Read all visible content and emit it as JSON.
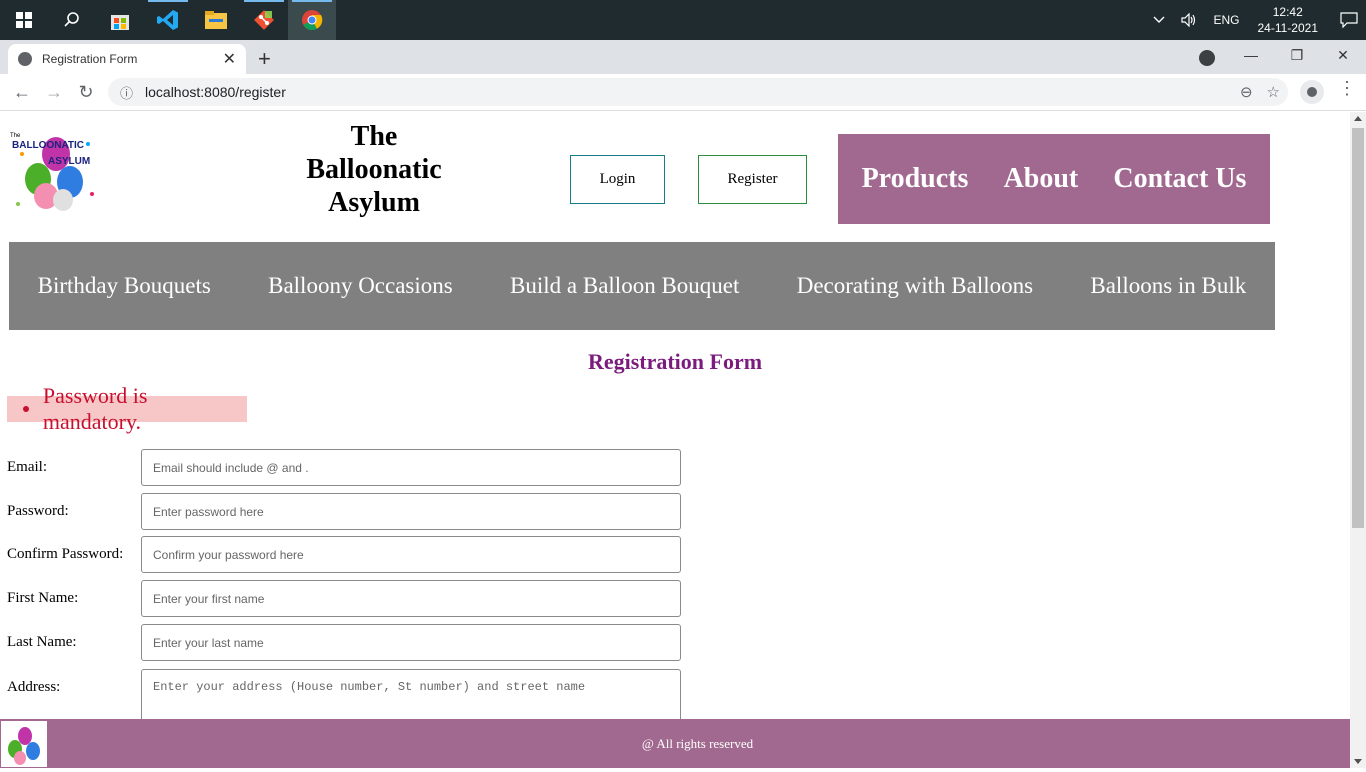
{
  "taskbar": {
    "time": "12:42",
    "date": "24-11-2021",
    "language": "ENG"
  },
  "browser": {
    "tab_title": "Registration Form",
    "url": "localhost:8080/register"
  },
  "site": {
    "title_line1": "The",
    "title_line2": "Balloonatic",
    "title_line3": "Asylum",
    "logo_text_line1": "The",
    "logo_text_line2": "BALLOONATIC",
    "logo_text_line3": "ASYLUM",
    "login_label": "Login",
    "register_label": "Register",
    "nav": [
      "Products",
      "About",
      "Contact Us"
    ],
    "categories": [
      "Birthday Bouquets",
      "Balloony Occasions",
      "Build a Balloon Bouquet",
      "Decorating with Balloons",
      "Balloons in Bulk"
    ],
    "nav_color": "#a1698f",
    "category_color": "#808080"
  },
  "form": {
    "heading": "Registration Form",
    "error": "Password is mandatory.",
    "fields": [
      {
        "label": "Email:",
        "placeholder": "Email should include @ and ."
      },
      {
        "label": "Password:",
        "placeholder": "Enter password here"
      },
      {
        "label": "Confirm Password:",
        "placeholder": "Confirm your password here"
      },
      {
        "label": "First Name:",
        "placeholder": "Enter your first name"
      },
      {
        "label": "Last Name:",
        "placeholder": "Enter your last name"
      },
      {
        "label": "Address:",
        "placeholder": "Enter your address (House number, St number) and street name"
      }
    ]
  },
  "footer": {
    "text": "@ All rights reserved"
  }
}
